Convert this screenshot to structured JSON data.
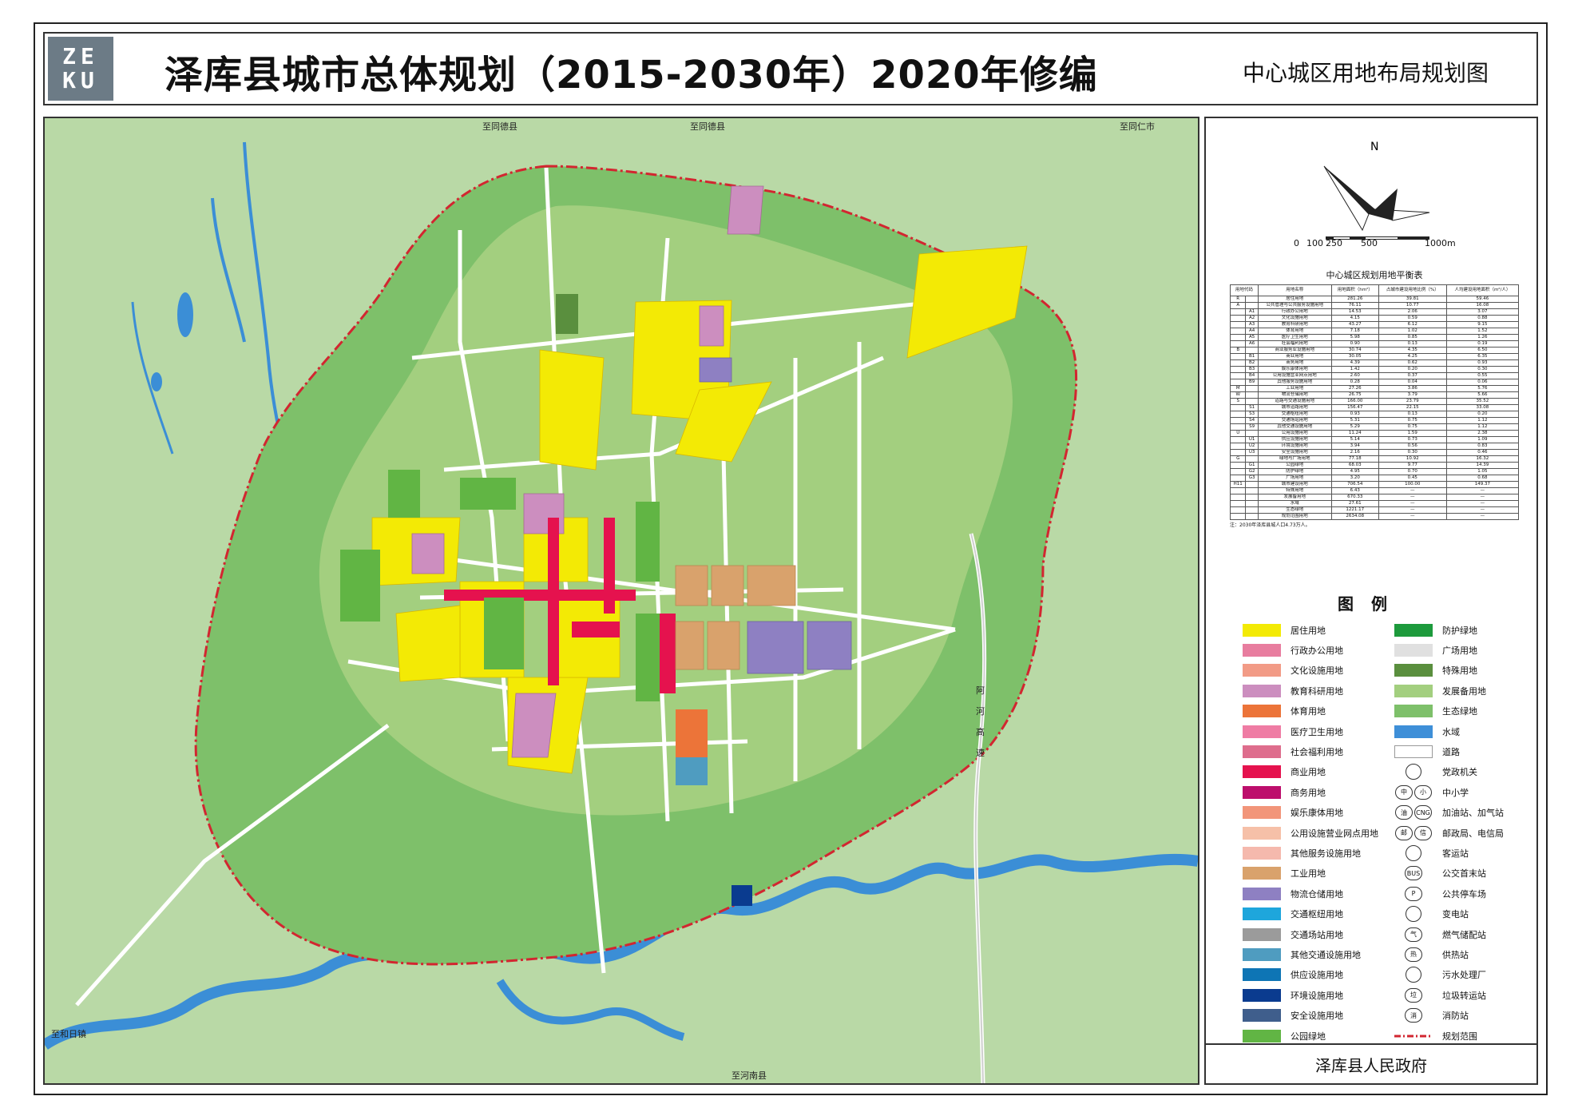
{
  "header": {
    "logo_lines": [
      "ZE",
      "KU"
    ],
    "title": "泽库县城市总体规划（2015-2030年）2020年修编",
    "subtitle": "中心城区用地布局规划图"
  },
  "map": {
    "direction_labels": [
      "至同德县",
      "至同德县",
      "至同仁市",
      "至和日镇",
      "至河南县"
    ],
    "highway_label": [
      "阿",
      "河",
      "高",
      "速"
    ]
  },
  "compass": {
    "north": "N"
  },
  "scale_bar": {
    "labels": [
      "0",
      "100",
      "250",
      "500",
      "1000m"
    ]
  },
  "balance_table": {
    "title": "中心城区规划用地平衡表",
    "header": [
      "用地代码",
      "用地名称",
      "用地面积（hm²）",
      "占城市建设用地比例（%）",
      "人均建设用地面积（m²/人）"
    ],
    "rows": [
      [
        "R",
        "",
        "居住用地",
        "281.26",
        "39.81",
        "59.46"
      ],
      [
        "A",
        "",
        "公共管理与公共服务设施用地",
        "76.11",
        "10.77",
        "16.08"
      ],
      [
        "",
        "A1",
        "行政办公用地",
        "14.53",
        "2.06",
        "3.07"
      ],
      [
        "",
        "A2",
        "文化设施用地",
        "4.15",
        "0.59",
        "0.88"
      ],
      [
        "",
        "A3",
        "教育科研用地",
        "43.27",
        "6.12",
        "9.15"
      ],
      [
        "",
        "A4",
        "体育用地",
        "7.18",
        "1.02",
        "1.52"
      ],
      [
        "",
        "A5",
        "医疗卫生用地",
        "5.98",
        "0.85",
        "1.26"
      ],
      [
        "",
        "A6",
        "社会福利用地",
        "0.90",
        "0.13",
        "0.19"
      ],
      [
        "B",
        "",
        "商业服务业设施用地",
        "30.74",
        "4.35",
        "6.50"
      ],
      [
        "",
        "B1",
        "商业用地",
        "30.05",
        "4.25",
        "6.35"
      ],
      [
        "",
        "B2",
        "商务用地",
        "4.39",
        "0.62",
        "0.93"
      ],
      [
        "",
        "B3",
        "娱乐康体用地",
        "1.42",
        "0.20",
        "0.30"
      ],
      [
        "",
        "B4",
        "公用设施营业网点用地",
        "2.60",
        "0.37",
        "0.55"
      ],
      [
        "",
        "B9",
        "其他服务设施用地",
        "0.28",
        "0.04",
        "0.06"
      ],
      [
        "M",
        "",
        "工业用地",
        "27.26",
        "3.86",
        "5.76"
      ],
      [
        "W",
        "",
        "物流仓储用地",
        "26.75",
        "3.79",
        "5.66"
      ],
      [
        "S",
        "",
        "道路与交通设施用地",
        "166.00",
        "23.79",
        "35.52"
      ],
      [
        "",
        "S1",
        "城市道路用地",
        "156.47",
        "22.15",
        "33.08"
      ],
      [
        "",
        "S3",
        "交通枢纽用地",
        "0.93",
        "0.13",
        "0.20"
      ],
      [
        "",
        "S4",
        "交通场站用地",
        "5.31",
        "0.75",
        "1.12"
      ],
      [
        "",
        "S9",
        "其他交通设施用地",
        "5.29",
        "0.75",
        "1.12"
      ],
      [
        "U",
        "",
        "公用设施用地",
        "11.24",
        "1.59",
        "2.38"
      ],
      [
        "",
        "U1",
        "供应设施用地",
        "5.14",
        "0.73",
        "1.09"
      ],
      [
        "",
        "U2",
        "环境设施用地",
        "3.94",
        "0.56",
        "0.83"
      ],
      [
        "",
        "U3",
        "安全设施用地",
        "2.16",
        "0.30",
        "0.46"
      ],
      [
        "G",
        "",
        "绿地与广场用地",
        "77.18",
        "10.92",
        "16.32"
      ],
      [
        "",
        "G1",
        "公园绿地",
        "68.03",
        "9.77",
        "14.39"
      ],
      [
        "",
        "G2",
        "防护绿地",
        "4.95",
        "0.70",
        "1.05"
      ],
      [
        "",
        "G3",
        "广场用地",
        "3.20",
        "0.45",
        "0.68"
      ],
      [
        "H11",
        "",
        "城市建设用地",
        "706.54",
        "100.00",
        "149.37"
      ],
      [
        "",
        "",
        "特殊用地",
        "6.43",
        "—",
        "—"
      ],
      [
        "",
        "",
        "发展备用地",
        "670.33",
        "—",
        "—"
      ],
      [
        "",
        "",
        "水域",
        "27.61",
        "—",
        "—"
      ],
      [
        "",
        "",
        "生态绿地",
        "1221.17",
        "—",
        "—"
      ],
      [
        "",
        "",
        "规划范围用地",
        "2634.08",
        "—",
        "—"
      ]
    ],
    "note": "注：2030年泽库县城人口4.73万人。"
  },
  "legend": {
    "title": "图例",
    "left": [
      {
        "label": "居住用地",
        "color": "#f3ea05"
      },
      {
        "label": "行政办公用地",
        "color": "#e87d9f"
      },
      {
        "label": "文化设施用地",
        "color": "#f29b86"
      },
      {
        "label": "教育科研用地",
        "color": "#cc8ebf"
      },
      {
        "label": "体育用地",
        "color": "#ec7439"
      },
      {
        "label": "医疗卫生用地",
        "color": "#ef7ca4"
      },
      {
        "label": "社会福利用地",
        "color": "#de6d8d"
      },
      {
        "label": "商业用地",
        "color": "#e5124e"
      },
      {
        "label": "商务用地",
        "color": "#bd0e6c"
      },
      {
        "label": "娱乐康体用地",
        "color": "#f2957a"
      },
      {
        "label": "公用设施营业网点用地",
        "color": "#f6c0a8"
      },
      {
        "label": "其他服务设施用地",
        "color": "#f5b9ad"
      },
      {
        "label": "工业用地",
        "color": "#d9a26c"
      },
      {
        "label": "物流仓储用地",
        "color": "#8e80c2"
      },
      {
        "label": "交通枢纽用地",
        "color": "#1ea6dc"
      },
      {
        "label": "交通场站用地",
        "color": "#9b9b9b"
      },
      {
        "label": "其他交通设施用地",
        "color": "#4f9cc0"
      },
      {
        "label": "供应设施用地",
        "color": "#0e75b5"
      },
      {
        "label": "环境设施用地",
        "color": "#0a3b8f"
      },
      {
        "label": "安全设施用地",
        "color": "#3f5e8c"
      },
      {
        "label": "公园绿地",
        "color": "#61b544"
      }
    ],
    "right": [
      {
        "label": "防护绿地",
        "color": "#1d9a3c"
      },
      {
        "label": "广场用地",
        "color": "#e0e0e0"
      },
      {
        "label": "特殊用地",
        "color": "#5a8f3e"
      },
      {
        "label": "发展备用地",
        "color": "#a3cf7f"
      },
      {
        "label": "生态绿地",
        "color": "#7ec06a"
      },
      {
        "label": "水域",
        "color": "#3e8fd8"
      },
      {
        "label": "道路",
        "color": "#ffffff"
      },
      {
        "label": "党政机关",
        "icon": "star"
      },
      {
        "label": "中小学",
        "icon": "school",
        "glyphs": [
          "中",
          "小"
        ]
      },
      {
        "label": "加油站、加气站",
        "icon": "fuel",
        "glyphs": [
          "油",
          "CNG"
        ]
      },
      {
        "label": "邮政局、电信局",
        "icon": "post",
        "glyphs": [
          "邮",
          "信"
        ]
      },
      {
        "label": "客运站",
        "icon": "bus-station"
      },
      {
        "label": "公交首末站",
        "icon": "bus",
        "glyphs": [
          "BUS"
        ]
      },
      {
        "label": "公共停车场",
        "icon": "parking",
        "glyphs": [
          "P"
        ]
      },
      {
        "label": "变电站",
        "icon": "power"
      },
      {
        "label": "燃气储配站",
        "icon": "gas",
        "glyphs": [
          "气"
        ]
      },
      {
        "label": "供热站",
        "icon": "heat",
        "glyphs": [
          "热"
        ]
      },
      {
        "label": "污水处理厂",
        "icon": "sewage"
      },
      {
        "label": "垃圾转运站",
        "icon": "waste",
        "glyphs": [
          "垃"
        ]
      },
      {
        "label": "消防站",
        "icon": "fire",
        "glyphs": [
          "消"
        ]
      },
      {
        "label": "规划范围",
        "icon": "boundary",
        "color": "#d22630"
      }
    ]
  },
  "footer": {
    "authority": "泽库县人民政府"
  }
}
